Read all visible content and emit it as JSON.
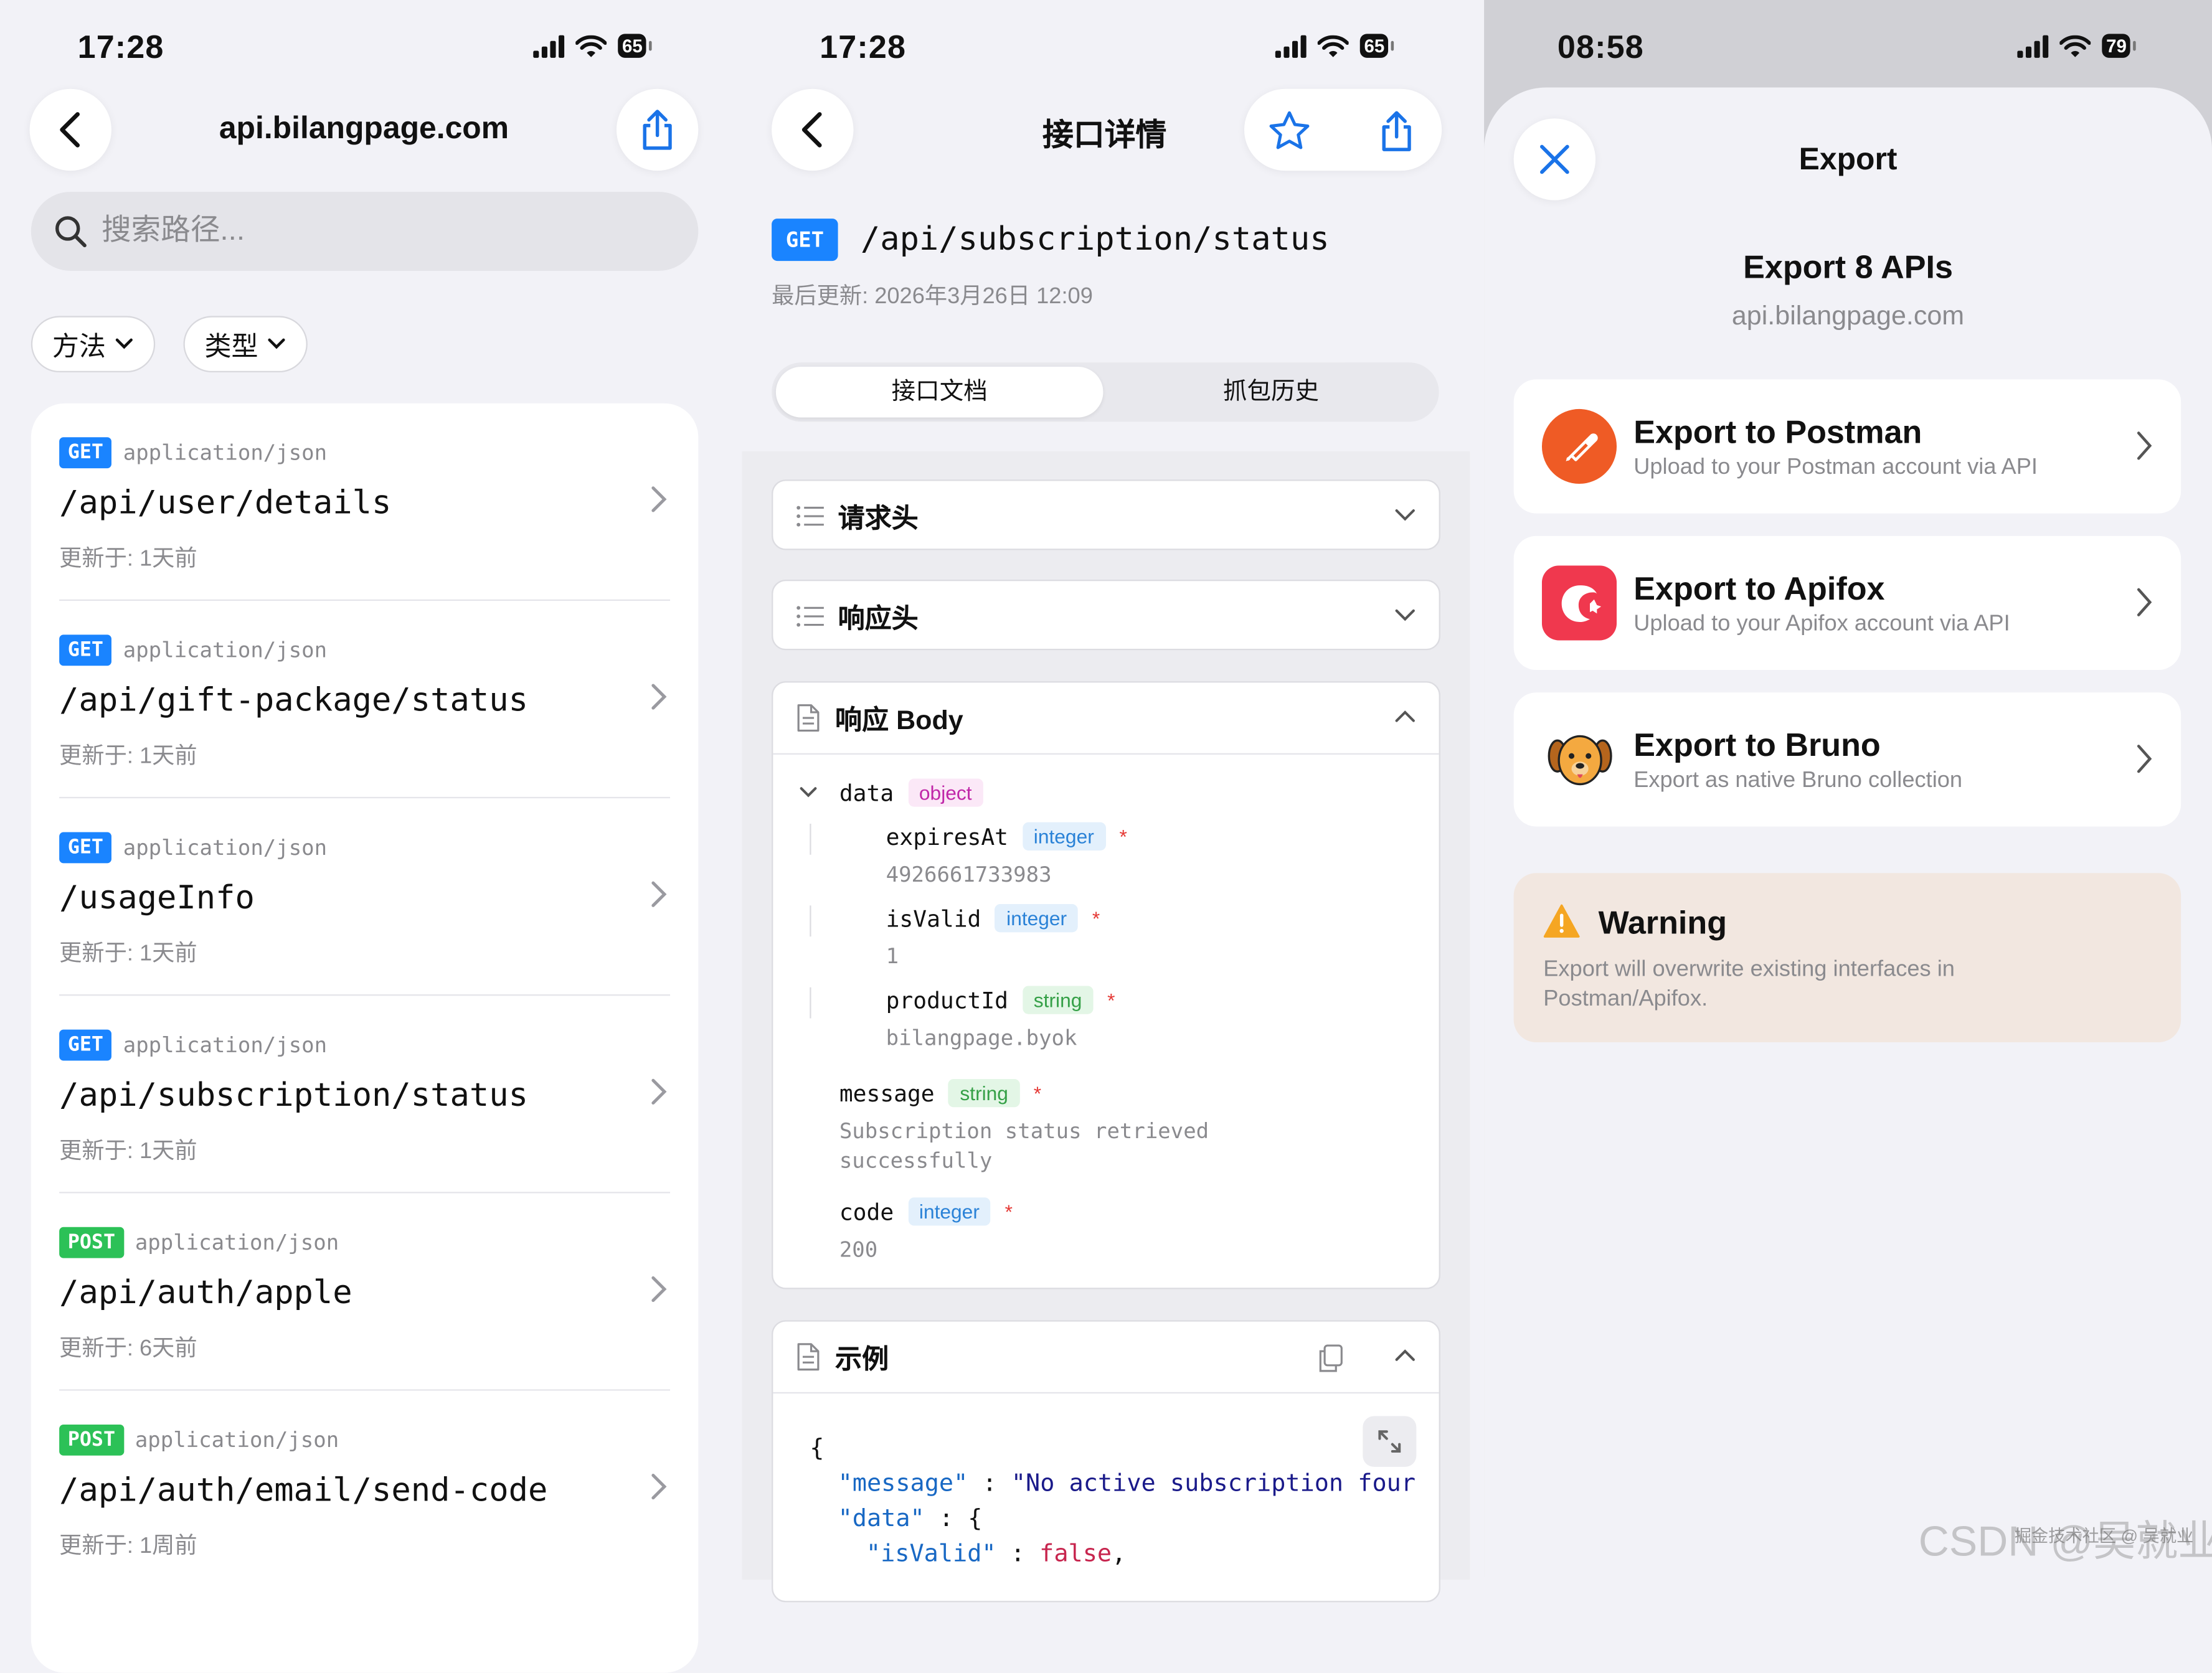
{
  "screen1": {
    "time": "17:28",
    "battery": "65",
    "title": "api.bilangpage.com",
    "search_placeholder": "搜索路径...",
    "filters": [
      "方法",
      "类型"
    ],
    "endpoints": [
      {
        "method": "GET",
        "content_type": "application/json",
        "path": "/api/user/details",
        "updated": "更新于: 1天前"
      },
      {
        "method": "GET",
        "content_type": "application/json",
        "path": "/api/gift-package/status",
        "updated": "更新于: 1天前"
      },
      {
        "method": "GET",
        "content_type": "application/json",
        "path": "/usageInfo",
        "updated": "更新于: 1天前"
      },
      {
        "method": "GET",
        "content_type": "application/json",
        "path": "/api/subscription/status",
        "updated": "更新于: 1天前"
      },
      {
        "method": "POST",
        "content_type": "application/json",
        "path": "/api/auth/apple",
        "updated": "更新于: 6天前"
      },
      {
        "method": "POST",
        "content_type": "application/json",
        "path": "/api/auth/email/send-code",
        "updated": "更新于: 1周前"
      }
    ]
  },
  "screen2": {
    "time": "17:28",
    "battery": "65",
    "title": "接口详情",
    "method": "GET",
    "path": "/api/subscription/status",
    "last_updated": "最后更新: 2026年3月26日 12:09",
    "tabs": [
      "接口文档",
      "抓包历史"
    ],
    "sections": {
      "request_headers": "请求头",
      "response_headers": "响应头",
      "response_body": "响应 Body",
      "example": "示例"
    },
    "body_fields": {
      "data": {
        "name": "data",
        "type": "object"
      },
      "expiresAt": {
        "name": "expiresAt",
        "type": "integer",
        "req": "*",
        "value": "4926661733983"
      },
      "isValid": {
        "name": "isValid",
        "type": "integer",
        "req": "*",
        "value": "1"
      },
      "productId": {
        "name": "productId",
        "type": "string",
        "req": "*",
        "value": "bilangpage.byok"
      },
      "message": {
        "name": "message",
        "type": "string",
        "req": "*",
        "value_line1": "Subscription status retrieved",
        "value_line2": "successfully"
      },
      "code": {
        "name": "code",
        "type": "integer",
        "req": "*",
        "value": "200"
      }
    },
    "example_code": {
      "open": "{",
      "line1_key": "\"message\"",
      "line1_sep": " : ",
      "line1_val": "\"No active subscription four",
      "line2_key": "\"data\"",
      "line2_rest": " : {",
      "line3_key": "\"isValid\"",
      "line3_sep": " : ",
      "line3_val": "false",
      "line3_end": ","
    }
  },
  "screen3": {
    "time": "08:58",
    "battery": "79",
    "title": "Export",
    "heading": "Export 8 APIs",
    "subheading": "api.bilangpage.com",
    "options": [
      {
        "title": "Export to Postman",
        "desc": "Upload to your Postman account via API"
      },
      {
        "title": "Export to Apifox",
        "desc": "Upload to your Apifox account via API"
      },
      {
        "title": "Export to Bruno",
        "desc": "Export as native Bruno collection"
      }
    ],
    "warning_title": "Warning",
    "warning_text": "Export will overwrite existing interfaces in Postman/Apifox."
  },
  "watermark": "CSDN @吴就业",
  "watermark_small": "掘金技术社区 @ 吴就业",
  "colors": {
    "get": "#1a84ff",
    "post": "#2cc157",
    "accent": "#1a73e8",
    "postman": "#ef5b25",
    "apifox": "#f0384e",
    "warning": "#f5a623"
  }
}
